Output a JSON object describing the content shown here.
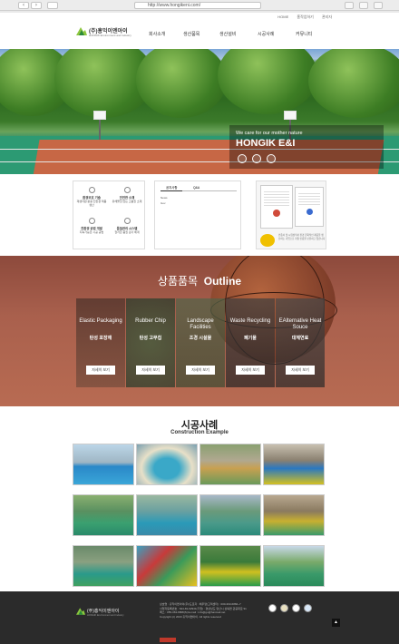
{
  "browser": {
    "url": "http://www.hongikeni.com/"
  },
  "utility_links": [
    "HOME",
    "홈작업하기",
    "관리자"
  ],
  "logo": {
    "text": "(주)홍익이엔아이",
    "sub": "HONGIK Environment and Industry"
  },
  "menu": [
    "회사소개",
    "생산품목",
    "생산설비",
    "시공사례",
    "커뮤니티"
  ],
  "hero": {
    "tagline": "We care for our mother nature",
    "brand": "HONGIK E&I"
  },
  "features": [
    {
      "title": "환경보호 기술",
      "desc": "재생자원 활용 친환경 제품 생산"
    },
    {
      "title": "안전한 소재",
      "desc": "유해물질 없는 고품질 소재"
    },
    {
      "title": "친환경 공법 개발",
      "desc": "지속가능한 시공 공법"
    },
    {
      "title": "품질관리 시스템",
      "desc": "철저한 품질 검사 체계"
    }
  ],
  "board": {
    "tabs": [
      "공지사항",
      "Q&A"
    ],
    "items": [
      "News",
      "Gov"
    ]
  },
  "certificate": {
    "caption": "인증서 및 시험성적서 환경 친화적인 제품을 생산하는 기업으로 각종 인증을 보유하고 있습니다"
  },
  "outline": {
    "title_ko": "상품품목",
    "title_en": "Outline"
  },
  "cards": [
    {
      "en": "Elastic Packaging",
      "ko": "탄성 포장재",
      "btn": "자세히 보기"
    },
    {
      "en": "Rubber Chip",
      "ko": "탄성 고무칩",
      "btn": "자세히 보기"
    },
    {
      "en": "Landscape Facilities",
      "ko": "조경 시설물",
      "btn": "자세히 보기"
    },
    {
      "en": "Waste Recycling",
      "ko": "폐기물",
      "btn": "자세히 보기"
    },
    {
      "en": "EAlternative Heat Souce",
      "ko": "대체연료",
      "btn": "자세히 보기"
    }
  ],
  "construction": {
    "title": "시공사례",
    "subtitle": "Construction Example"
  },
  "footer": {
    "lines": [
      "상호명 : 홍익이엔아이(주)/도로자 : 배우영(고객센터) : 000-363-6866~7",
      "사업자등록번호 : 624-81-92941(기업) : 경상남도 양산시 상북면 관공대로 91",
      "팩스 : 055-363-6868(S) E-mail : info@gu@hanmail.net",
      "Copyright (c) 2023 홍익이엔아이. All rights reserved"
    ],
    "top": "▲"
  }
}
